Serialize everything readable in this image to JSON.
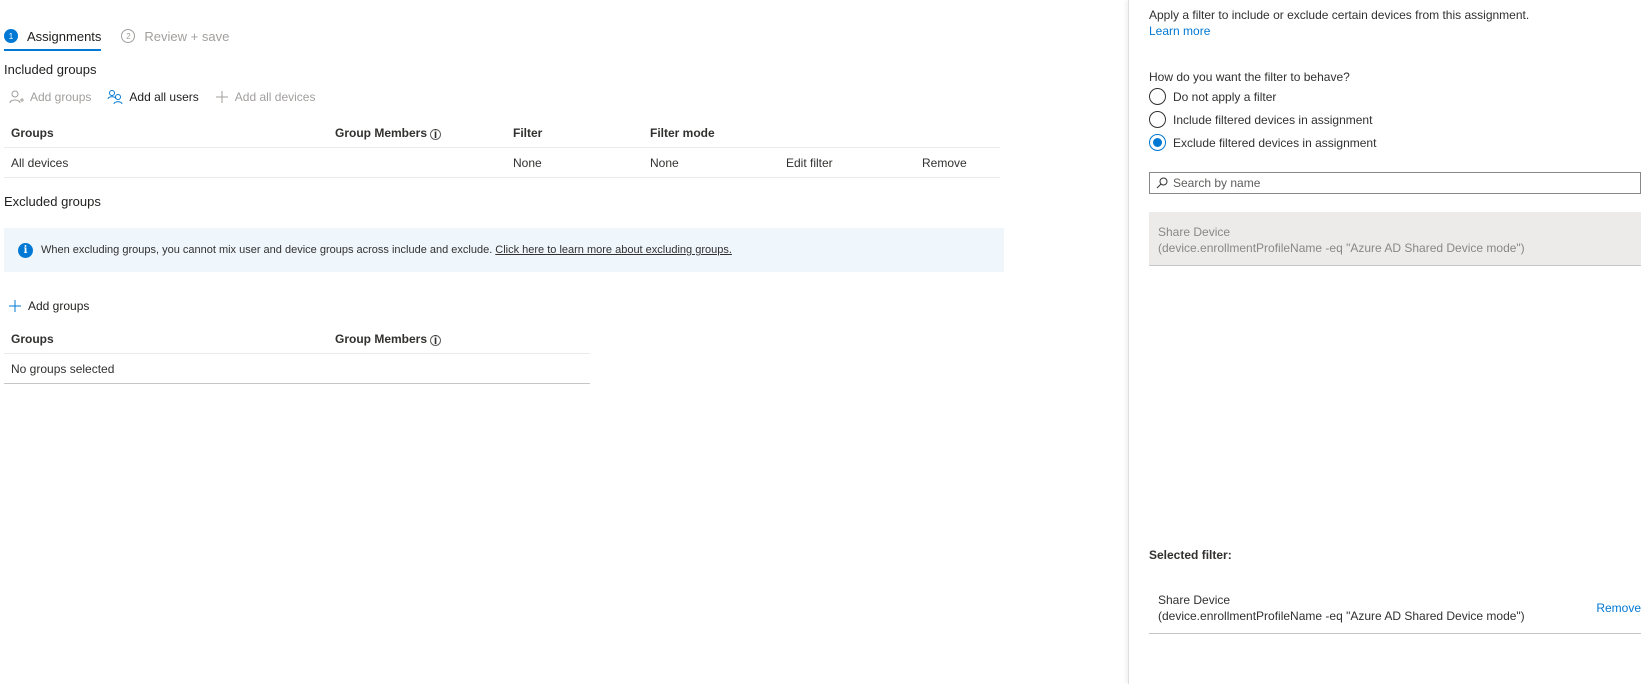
{
  "wizard": {
    "steps": [
      {
        "number": "1",
        "label": "Assignments"
      },
      {
        "number": "2",
        "label": "Review + save"
      }
    ]
  },
  "included": {
    "title": "Included groups",
    "toolbar": {
      "add_groups": "Add groups",
      "add_all_users": "Add all users",
      "add_all_devices": "Add all devices"
    },
    "columns": {
      "groups": "Groups",
      "group_members": "Group Members",
      "filter": "Filter",
      "filter_mode": "Filter mode"
    },
    "rows": [
      {
        "group": "All devices",
        "filter": "None",
        "filter_mode": "None",
        "edit_filter": "Edit filter",
        "remove": "Remove"
      }
    ]
  },
  "excluded": {
    "title": "Excluded groups",
    "info_icon": "i",
    "info_text": "When excluding groups, you cannot mix user and device groups across include and exclude.",
    "info_link": "Click here to learn more about excluding groups.",
    "add_groups": "Add groups",
    "columns": {
      "groups": "Groups",
      "group_members": "Group Members"
    },
    "empty_text": "No groups selected"
  },
  "panel": {
    "description": "Apply a filter to include or exclude certain devices from this assignment.",
    "learn_more": "Learn more",
    "question": "How do you want the filter to behave?",
    "options": [
      {
        "label": "Do not apply a filter",
        "checked": false
      },
      {
        "label": "Include filtered devices in assignment",
        "checked": false
      },
      {
        "label": "Exclude filtered devices in assignment",
        "checked": true
      }
    ],
    "search_placeholder": "Search by name",
    "filters": [
      {
        "name": "Share Device",
        "rule": "(device.enrollmentProfileName -eq \"Azure AD Shared Device mode\")"
      }
    ],
    "selected_title": "Selected filter:",
    "selected": {
      "name": "Share Device",
      "rule": "(device.enrollmentProfileName -eq \"Azure AD Shared Device mode\")",
      "remove": "Remove"
    }
  },
  "colors": {
    "accent": "#0078d4",
    "infobar_bg": "#eff6fc",
    "disabled_text": "#a19f9d"
  }
}
